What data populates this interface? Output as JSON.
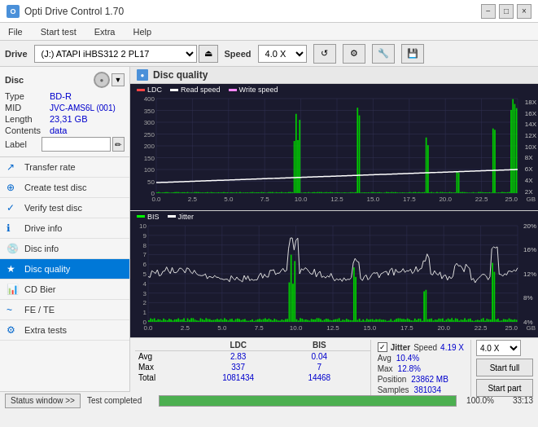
{
  "titlebar": {
    "title": "Opti Drive Control 1.70",
    "minimize": "−",
    "maximize": "□",
    "close": "×"
  },
  "menubar": {
    "items": [
      "File",
      "Start test",
      "Extra",
      "Help"
    ]
  },
  "drivebar": {
    "drive_label": "Drive",
    "drive_value": "(J:)  ATAPI iHBS312  2 PL17",
    "speed_label": "Speed",
    "speed_value": "4.0 X"
  },
  "sidebar": {
    "disc_section": {
      "title": "Disc",
      "type_label": "Type",
      "type_value": "BD-R",
      "mid_label": "MID",
      "mid_value": "JVC-AMS6L (001)",
      "length_label": "Length",
      "length_value": "23,31 GB",
      "contents_label": "Contents",
      "contents_value": "data",
      "label_label": "Label",
      "label_value": ""
    },
    "nav_items": [
      {
        "id": "transfer-rate",
        "label": "Transfer rate",
        "icon": "↗"
      },
      {
        "id": "create-test-disc",
        "label": "Create test disc",
        "icon": "⊕"
      },
      {
        "id": "verify-test-disc",
        "label": "Verify test disc",
        "icon": "✓"
      },
      {
        "id": "drive-info",
        "label": "Drive info",
        "icon": "ℹ"
      },
      {
        "id": "disc-info",
        "label": "Disc info",
        "icon": "💿"
      },
      {
        "id": "disc-quality",
        "label": "Disc quality",
        "icon": "★",
        "active": true
      },
      {
        "id": "cd-bier",
        "label": "CD Bier",
        "icon": "📊"
      },
      {
        "id": "fe-te",
        "label": "FE / TE",
        "icon": "~"
      },
      {
        "id": "extra-tests",
        "label": "Extra tests",
        "icon": "⚙"
      }
    ]
  },
  "disc_quality": {
    "title": "Disc quality",
    "legend_upper": [
      "LDC",
      "Read speed",
      "Write speed"
    ],
    "legend_lower": [
      "BIS",
      "Jitter"
    ],
    "x_labels": [
      "0.0",
      "2.5",
      "5.0",
      "7.5",
      "10.0",
      "12.5",
      "15.0",
      "17.5",
      "20.0",
      "22.5",
      "25.0"
    ],
    "y_upper_left": [
      "400",
      "350",
      "300",
      "250",
      "200",
      "150",
      "100",
      "50"
    ],
    "y_upper_right": [
      "18X",
      "16X",
      "14X",
      "12X",
      "10X",
      "8X",
      "6X",
      "4X",
      "2X"
    ],
    "y_lower_left": [
      "10",
      "9",
      "8",
      "7",
      "6",
      "5",
      "4",
      "3",
      "2",
      "1"
    ],
    "y_lower_right": [
      "20%",
      "16%",
      "12%",
      "8%",
      "4%"
    ]
  },
  "stats": {
    "headers": [
      "LDC",
      "BIS",
      "",
      "Jitter",
      "Speed"
    ],
    "avg_label": "Avg",
    "avg_ldc": "2.83",
    "avg_bis": "0.04",
    "avg_jitter": "10.4%",
    "avg_speed": "4.19 X",
    "max_label": "Max",
    "max_ldc": "337",
    "max_bis": "7",
    "max_jitter": "12.8%",
    "total_label": "Total",
    "total_ldc": "1081434",
    "total_bis": "14468",
    "position_label": "Position",
    "position_value": "23862 MB",
    "samples_label": "Samples",
    "samples_value": "381034",
    "speed_select": "4.0 X",
    "start_full": "Start full",
    "start_part": "Start part",
    "jitter_checked": true
  },
  "statusbar": {
    "status_window_btn": "Status window >>",
    "status_text": "Test completed",
    "progress": 100,
    "percent": "100.0%",
    "time": "33:13"
  }
}
